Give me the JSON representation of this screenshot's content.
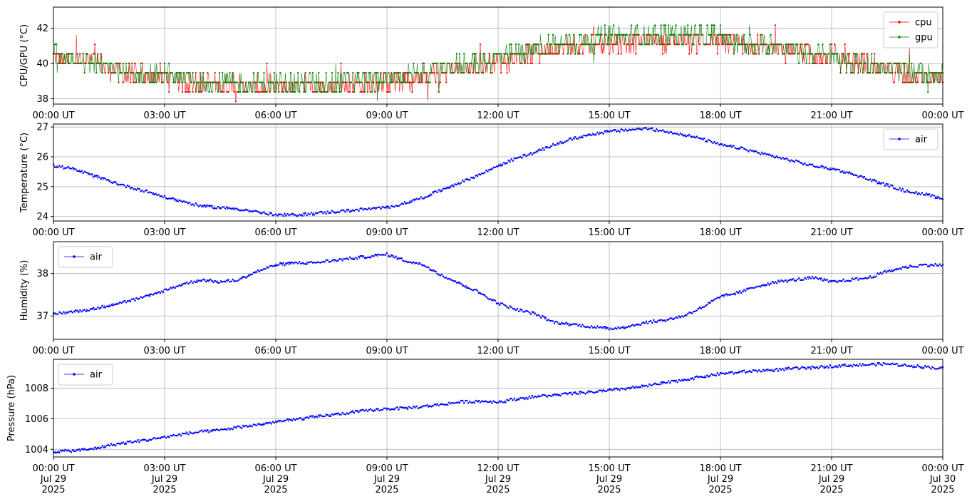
{
  "chart_data": [
    {
      "type": "line",
      "ylabel": "CPU/GPU (°C)",
      "ylim": [
        37.7,
        43.2
      ],
      "yticks": [
        38,
        40,
        42
      ],
      "xlim": [
        0,
        24
      ],
      "xticks": [
        {
          "x": 0,
          "label": "00:00 UT"
        },
        {
          "x": 3,
          "label": "03:00 UT"
        },
        {
          "x": 6,
          "label": "06:00 UT"
        },
        {
          "x": 9,
          "label": "09:00 UT"
        },
        {
          "x": 12,
          "label": "12:00 UT"
        },
        {
          "x": 15,
          "label": "15:00 UT"
        },
        {
          "x": 18,
          "label": "18:00 UT"
        },
        {
          "x": 21,
          "label": "21:00 UT"
        },
        {
          "x": 24,
          "label": "00:00 UT"
        }
      ],
      "grid": true,
      "legend": "upper-right",
      "series": [
        {
          "name": "cpu",
          "color": "#ff0000",
          "x": [
            0,
            0.5,
            1,
            1.5,
            2,
            2.5,
            3,
            3.5,
            4,
            4.5,
            5,
            5.5,
            6,
            6.5,
            7,
            7.5,
            8,
            8.5,
            9,
            9.5,
            10,
            10.5,
            11,
            11.5,
            12,
            12.5,
            13,
            13.5,
            14,
            14.5,
            15,
            15.5,
            16,
            16.5,
            17,
            17.5,
            18,
            18.5,
            19,
            19.5,
            20,
            20.5,
            21,
            21.5,
            22,
            22.5,
            23,
            23.5,
            24
          ],
          "y": [
            40.2,
            40.2,
            40.0,
            39.7,
            39.3,
            39.2,
            39.2,
            39.0,
            38.8,
            38.7,
            38.7,
            38.7,
            38.6,
            38.6,
            38.7,
            38.7,
            38.8,
            38.8,
            38.9,
            39.0,
            39.2,
            39.4,
            39.6,
            39.8,
            40.0,
            40.3,
            40.6,
            40.8,
            40.9,
            41.0,
            41.1,
            41.2,
            41.3,
            41.3,
            41.3,
            41.2,
            41.1,
            41.0,
            40.9,
            40.8,
            40.7,
            40.5,
            40.3,
            40.1,
            39.9,
            39.6,
            39.3,
            39.1,
            39.2
          ]
        },
        {
          "name": "gpu",
          "color": "#008000",
          "x": [
            0,
            0.5,
            1,
            1.5,
            2,
            2.5,
            3,
            3.5,
            4,
            4.5,
            5,
            5.5,
            6,
            6.5,
            7,
            7.5,
            8,
            8.5,
            9,
            9.5,
            10,
            10.5,
            11,
            11.5,
            12,
            12.5,
            13,
            13.5,
            14,
            14.5,
            15,
            15.5,
            16,
            16.5,
            17,
            17.5,
            18,
            18.5,
            19,
            19.5,
            20,
            20.5,
            21,
            21.5,
            22,
            22.5,
            23,
            23.5,
            24
          ],
          "y": [
            40.3,
            40.3,
            40.0,
            39.7,
            39.4,
            39.3,
            39.2,
            39.1,
            38.9,
            38.8,
            38.8,
            38.8,
            38.8,
            38.8,
            38.9,
            38.9,
            39.0,
            39.0,
            39.1,
            39.2,
            39.4,
            39.6,
            39.8,
            40.0,
            40.2,
            40.5,
            40.8,
            41.0,
            41.1,
            41.3,
            41.4,
            41.5,
            41.6,
            41.6,
            41.6,
            41.5,
            41.4,
            41.2,
            41.0,
            40.9,
            40.7,
            40.5,
            40.3,
            40.1,
            39.9,
            39.7,
            39.5,
            39.4,
            39.5
          ]
        }
      ]
    },
    {
      "type": "line",
      "ylabel": "Temperature (°C)",
      "ylim": [
        23.85,
        27.1
      ],
      "yticks": [
        24,
        25,
        26,
        27
      ],
      "xlim": [
        0,
        24
      ],
      "xticks": [
        {
          "x": 0,
          "label": "00:00 UT"
        },
        {
          "x": 3,
          "label": "03:00 UT"
        },
        {
          "x": 6,
          "label": "06:00 UT"
        },
        {
          "x": 9,
          "label": "09:00 UT"
        },
        {
          "x": 12,
          "label": "12:00 UT"
        },
        {
          "x": 15,
          "label": "15:00 UT"
        },
        {
          "x": 18,
          "label": "18:00 UT"
        },
        {
          "x": 21,
          "label": "21:00 UT"
        },
        {
          "x": 24,
          "label": "00:00 UT"
        }
      ],
      "grid": true,
      "legend": "upper-right",
      "series": [
        {
          "name": "air",
          "color": "#0000ff",
          "x": [
            0,
            0.5,
            1,
            1.5,
            2,
            2.5,
            3,
            3.5,
            4,
            4.5,
            5,
            5.5,
            6,
            6.5,
            7,
            7.5,
            8,
            8.5,
            9,
            9.5,
            10,
            10.5,
            11,
            11.5,
            12,
            12.5,
            13,
            13.5,
            14,
            14.5,
            15,
            15.5,
            16,
            16.5,
            17,
            17.5,
            18,
            18.5,
            19,
            19.5,
            20,
            20.5,
            21,
            21.5,
            22,
            22.5,
            23,
            23.5,
            24
          ],
          "y": [
            25.7,
            25.6,
            25.4,
            25.2,
            25.0,
            24.85,
            24.65,
            24.5,
            24.35,
            24.3,
            24.25,
            24.15,
            24.05,
            24.05,
            24.1,
            24.15,
            24.2,
            24.25,
            24.3,
            24.45,
            24.65,
            24.9,
            25.15,
            25.4,
            25.7,
            25.95,
            26.15,
            26.4,
            26.6,
            26.75,
            26.85,
            26.9,
            26.95,
            26.85,
            26.75,
            26.6,
            26.4,
            26.3,
            26.15,
            26.0,
            25.85,
            25.7,
            25.6,
            25.45,
            25.25,
            25.05,
            24.85,
            24.75,
            24.6
          ]
        }
      ]
    },
    {
      "type": "line",
      "ylabel": "Humidity (%)",
      "ylim": [
        36.45,
        38.75
      ],
      "yticks": [
        37,
        38
      ],
      "xlim": [
        0,
        24
      ],
      "xticks": [
        {
          "x": 0,
          "label": "00:00 UT"
        },
        {
          "x": 3,
          "label": "03:00 UT"
        },
        {
          "x": 6,
          "label": "06:00 UT"
        },
        {
          "x": 9,
          "label": "09:00 UT"
        },
        {
          "x": 12,
          "label": "12:00 UT"
        },
        {
          "x": 15,
          "label": "15:00 UT"
        },
        {
          "x": 18,
          "label": "18:00 UT"
        },
        {
          "x": 21,
          "label": "21:00 UT"
        },
        {
          "x": 24,
          "label": "00:00 UT"
        }
      ],
      "grid": true,
      "legend": "upper-left",
      "series": [
        {
          "name": "air",
          "color": "#0000ff",
          "x": [
            0,
            0.5,
            1,
            1.5,
            2,
            2.5,
            3,
            3.5,
            4,
            4.5,
            5,
            5.5,
            6,
            6.5,
            7,
            7.5,
            8,
            8.5,
            9,
            9.5,
            10,
            10.5,
            11,
            11.5,
            12,
            12.5,
            13,
            13.5,
            14,
            14.5,
            15,
            15.5,
            16,
            16.5,
            17,
            17.5,
            18,
            18.5,
            19,
            19.5,
            20,
            20.5,
            21,
            21.5,
            22,
            22.5,
            23,
            23.5,
            24
          ],
          "y": [
            37.05,
            37.1,
            37.15,
            37.25,
            37.35,
            37.45,
            37.6,
            37.75,
            37.85,
            37.8,
            37.85,
            38.05,
            38.2,
            38.25,
            38.25,
            38.3,
            38.35,
            38.4,
            38.45,
            38.3,
            38.2,
            37.95,
            37.75,
            37.55,
            37.3,
            37.15,
            37.05,
            36.85,
            36.8,
            36.75,
            36.7,
            36.75,
            36.85,
            36.9,
            37.0,
            37.2,
            37.45,
            37.55,
            37.7,
            37.8,
            37.85,
            37.9,
            37.8,
            37.85,
            37.9,
            38.05,
            38.15,
            38.2,
            38.2
          ]
        }
      ]
    },
    {
      "type": "line",
      "ylabel": "Pressure (hPa)",
      "ylim": [
        1003.5,
        1009.9
      ],
      "yticks": [
        1004,
        1006,
        1008
      ],
      "xlim": [
        0,
        24
      ],
      "xticks": [
        {
          "x": 0,
          "label": "00:00 UT",
          "date": "Jul 29",
          "year": "2025"
        },
        {
          "x": 3,
          "label": "03:00 UT",
          "date": "Jul 29",
          "year": "2025"
        },
        {
          "x": 6,
          "label": "06:00 UT",
          "date": "Jul 29",
          "year": "2025"
        },
        {
          "x": 9,
          "label": "09:00 UT",
          "date": "Jul 29",
          "year": "2025"
        },
        {
          "x": 12,
          "label": "12:00 UT",
          "date": "Jul 29",
          "year": "2025"
        },
        {
          "x": 15,
          "label": "15:00 UT",
          "date": "Jul 29",
          "year": "2025"
        },
        {
          "x": 18,
          "label": "18:00 UT",
          "date": "Jul 29",
          "year": "2025"
        },
        {
          "x": 21,
          "label": "21:00 UT",
          "date": "Jul 29",
          "year": "2025"
        },
        {
          "x": 24,
          "label": "00:00 UT",
          "date": "Jul 30",
          "year": "2025"
        }
      ],
      "grid": true,
      "legend": "upper-left",
      "series": [
        {
          "name": "air",
          "color": "#0000ff",
          "x": [
            0,
            0.5,
            1,
            1.5,
            2,
            2.5,
            3,
            3.5,
            4,
            4.5,
            5,
            5.5,
            6,
            6.5,
            7,
            7.5,
            8,
            8.5,
            9,
            9.5,
            10,
            10.5,
            11,
            11.5,
            12,
            12.5,
            13,
            13.5,
            14,
            14.5,
            15,
            15.5,
            16,
            16.5,
            17,
            17.5,
            18,
            18.5,
            19,
            19.5,
            20,
            20.5,
            21,
            21.5,
            22,
            22.5,
            23,
            23.5,
            24
          ],
          "y": [
            1003.85,
            1003.9,
            1004.0,
            1004.25,
            1004.45,
            1004.6,
            1004.8,
            1005.0,
            1005.15,
            1005.25,
            1005.45,
            1005.6,
            1005.8,
            1005.95,
            1006.1,
            1006.25,
            1006.4,
            1006.55,
            1006.65,
            1006.7,
            1006.8,
            1006.95,
            1007.1,
            1007.15,
            1007.1,
            1007.3,
            1007.45,
            1007.55,
            1007.65,
            1007.75,
            1007.85,
            1008.0,
            1008.15,
            1008.35,
            1008.55,
            1008.75,
            1008.95,
            1009.05,
            1009.15,
            1009.2,
            1009.3,
            1009.35,
            1009.45,
            1009.5,
            1009.55,
            1009.6,
            1009.5,
            1009.4,
            1009.3
          ]
        }
      ]
    }
  ]
}
